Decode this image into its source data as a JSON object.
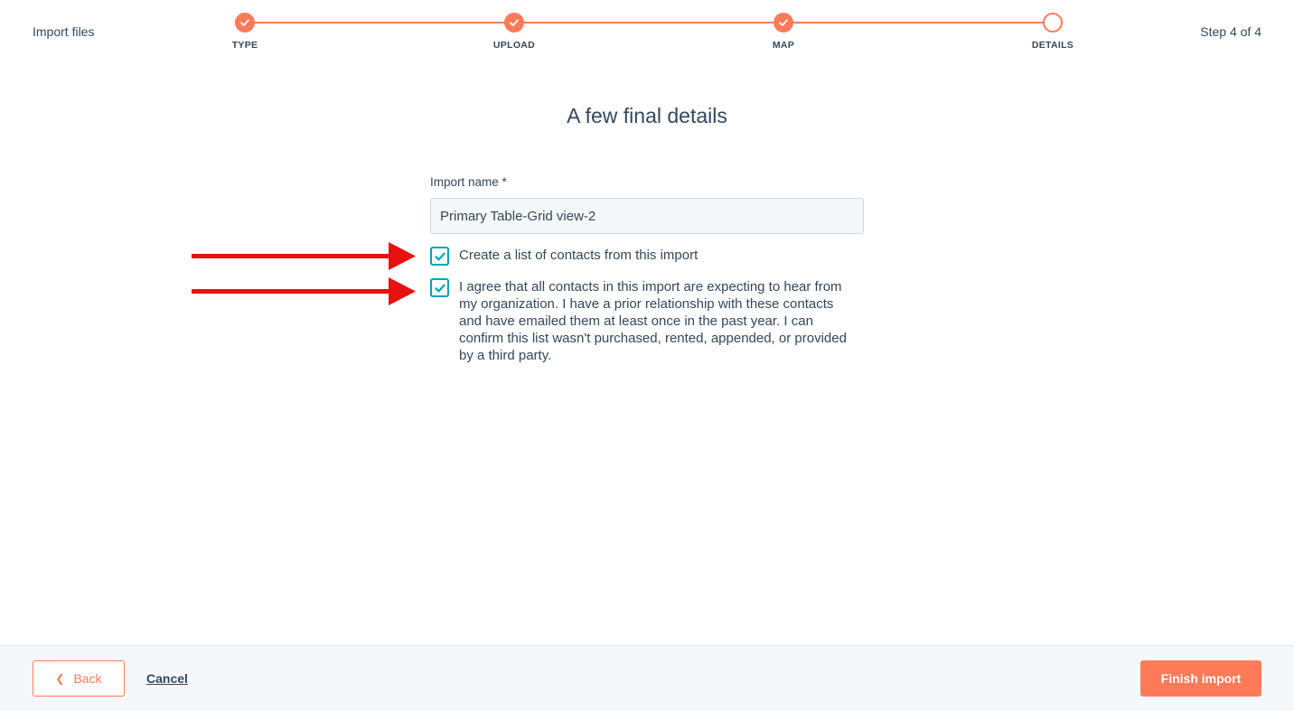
{
  "header": {
    "title": "Import files",
    "step_counter": "Step 4 of 4"
  },
  "stepper": {
    "steps": [
      {
        "label": "TYPE",
        "state": "complete",
        "icon": "checkmark-icon"
      },
      {
        "label": "UPLOAD",
        "state": "complete",
        "icon": "checkmark-icon"
      },
      {
        "label": "MAP",
        "state": "complete",
        "icon": "checkmark-icon"
      },
      {
        "label": "DETAILS",
        "state": "current",
        "icon": "empty-circle-icon"
      }
    ]
  },
  "main": {
    "heading": "A few final details",
    "import_name_label": "Import name *",
    "import_name_value": "Primary Table-Grid view-2",
    "create_list_checkbox": {
      "checked": true,
      "label": "Create a list of contacts from this import"
    },
    "consent_checkbox": {
      "checked": true,
      "label": "I agree that all contacts in this import are expecting to hear from my organization. I have a prior relationship with these contacts and have emailed them at least once in the past year. I can confirm this list wasn't purchased, rented, appended, or provided by a third party."
    }
  },
  "footer": {
    "back_label": "Back",
    "cancel_label": "Cancel",
    "finish_label": "Finish import"
  },
  "colors": {
    "accent": "#ff7a59",
    "checkbox": "#00a4bd",
    "text": "#33475b",
    "annotation_arrow": "#e8110f"
  }
}
